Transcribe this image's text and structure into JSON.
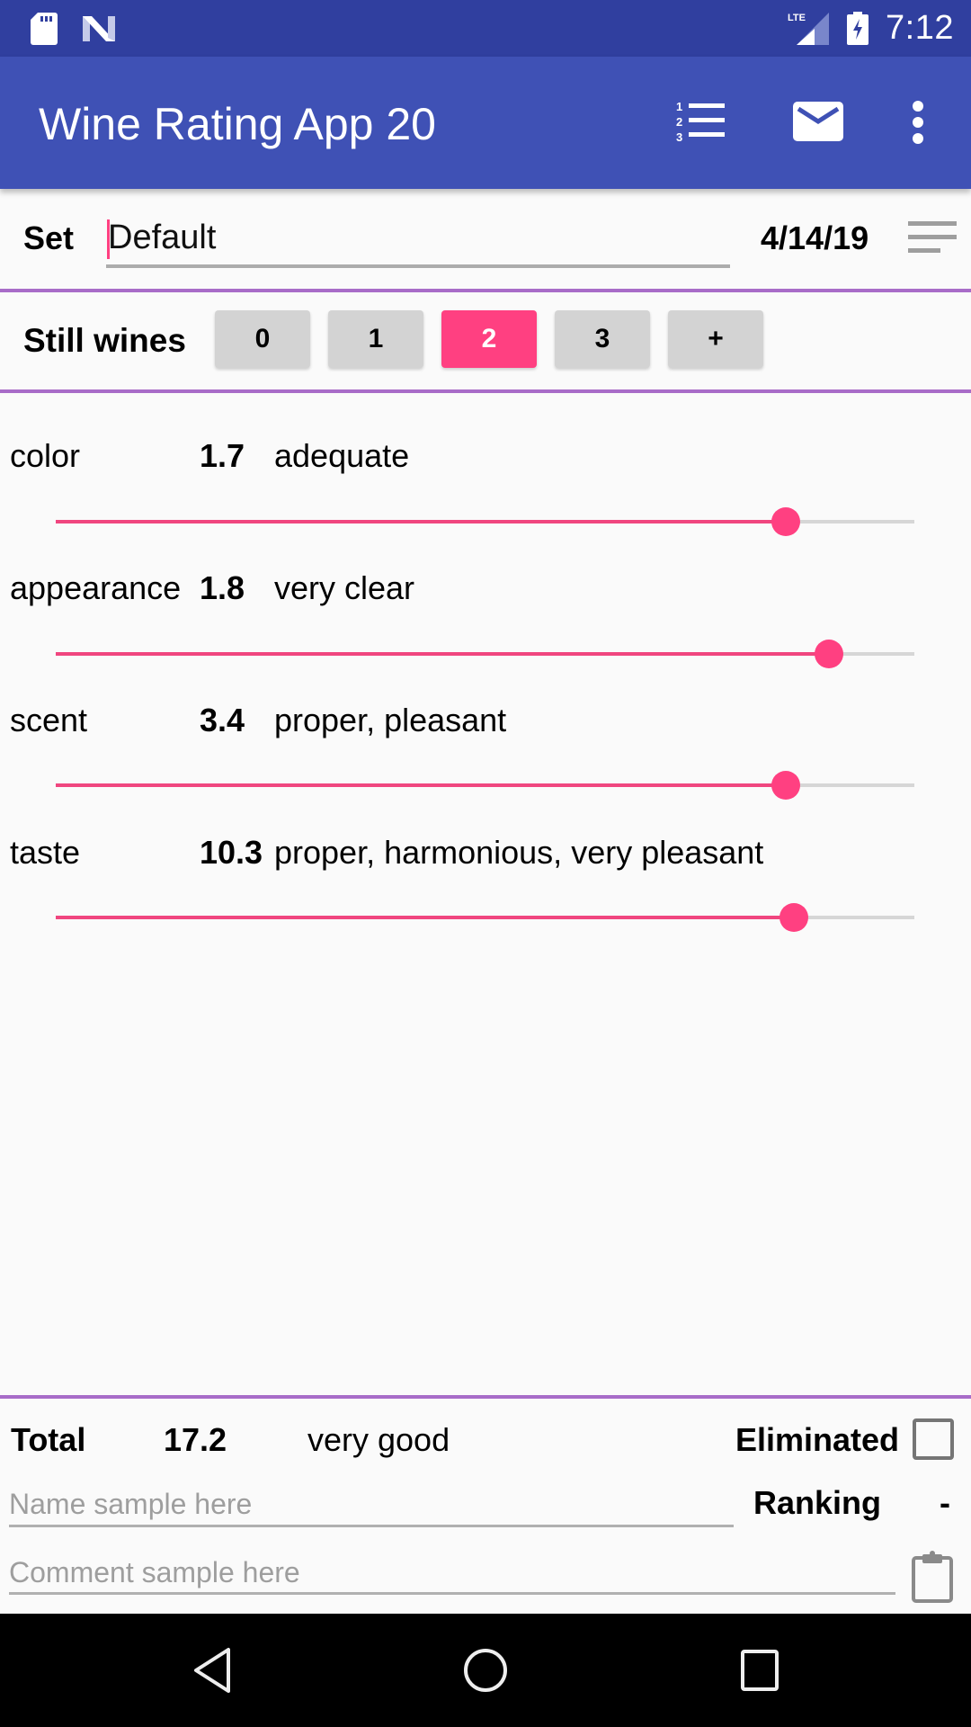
{
  "status_bar": {
    "time": "7:12",
    "icons": [
      "sd-card-icon",
      "n-notification-icon",
      "lte-signal-icon",
      "battery-charging-icon"
    ]
  },
  "toolbar": {
    "title": "Wine Rating App 20",
    "actions": [
      "ranking-list-icon",
      "mail-icon",
      "more-vert-icon"
    ]
  },
  "set_row": {
    "label": "Set",
    "value": "Default",
    "date": "4/14/19",
    "sort_icon": "sort-icon"
  },
  "category_row": {
    "label": "Still wines",
    "buttons": [
      {
        "label": "0",
        "active": false
      },
      {
        "label": "1",
        "active": false
      },
      {
        "label": "2",
        "active": true
      },
      {
        "label": "3",
        "active": false
      },
      {
        "label": "+",
        "active": false
      }
    ]
  },
  "criteria": [
    {
      "name": "color",
      "score": "1.7",
      "description": "adequate",
      "slider_fraction": 0.85
    },
    {
      "name": "appearance",
      "score": "1.8",
      "description": "very clear",
      "slider_fraction": 0.9
    },
    {
      "name": "scent",
      "score": "3.4",
      "description": "proper, pleasant",
      "slider_fraction": 0.85
    },
    {
      "name": "taste",
      "score": "10.3",
      "description": "proper, harmonious, very pleasant",
      "slider_fraction": 0.86
    }
  ],
  "footer": {
    "total_label": "Total",
    "total_score": "17.2",
    "total_description": "very good",
    "eliminated_label": "Eliminated",
    "eliminated_checked": false,
    "ranking_label": "Ranking",
    "ranking_value": "-",
    "name_value": "",
    "name_placeholder": "Name sample here",
    "comment_value": "",
    "comment_placeholder": "Comment sample here"
  },
  "colors": {
    "status_bar": "#303F9F",
    "primary": "#3F51B5",
    "accent": "#FF4081",
    "divider": "#A86CC8",
    "button_inactive": "#D3D3D3"
  },
  "nav_bar": {
    "buttons": [
      "back-icon",
      "home-icon",
      "recents-icon"
    ]
  }
}
